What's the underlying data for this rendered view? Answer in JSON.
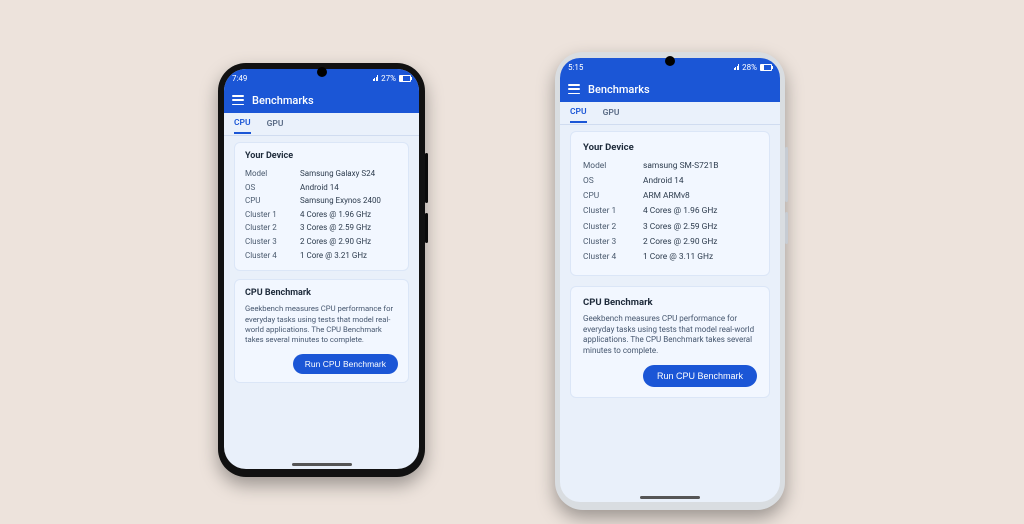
{
  "phones": [
    {
      "status": {
        "time": "7:49",
        "battery_pct": "27%"
      },
      "app_title": "Benchmarks",
      "tabs": {
        "cpu": "CPU",
        "gpu": "GPU"
      },
      "device_card_title": "Your Device",
      "specs": [
        {
          "label": "Model",
          "value": "Samsung Galaxy S24"
        },
        {
          "label": "OS",
          "value": "Android 14"
        },
        {
          "label": "CPU",
          "value": "Samsung Exynos 2400"
        },
        {
          "label": "Cluster 1",
          "value": "4 Cores @ 1.96 GHz"
        },
        {
          "label": "Cluster 2",
          "value": "3 Cores @ 2.59 GHz"
        },
        {
          "label": "Cluster 3",
          "value": "2 Cores @ 2.90 GHz"
        },
        {
          "label": "Cluster 4",
          "value": "1 Core @ 3.21 GHz"
        }
      ],
      "bench_card_title": "CPU Benchmark",
      "bench_desc": "Geekbench measures CPU performance for everyday tasks using tests that model real-world applications. The CPU Benchmark takes several minutes to complete.",
      "run_label": "Run CPU Benchmark"
    },
    {
      "status": {
        "time": "5:15",
        "battery_pct": "28%"
      },
      "app_title": "Benchmarks",
      "tabs": {
        "cpu": "CPU",
        "gpu": "GPU"
      },
      "device_card_title": "Your Device",
      "specs": [
        {
          "label": "Model",
          "value": "samsung SM-S721B"
        },
        {
          "label": "OS",
          "value": "Android 14"
        },
        {
          "label": "CPU",
          "value": "ARM ARMv8"
        },
        {
          "label": "Cluster 1",
          "value": "4 Cores @ 1.96 GHz"
        },
        {
          "label": "Cluster 2",
          "value": "3 Cores @ 2.59 GHz"
        },
        {
          "label": "Cluster 3",
          "value": "2 Cores @ 2.90 GHz"
        },
        {
          "label": "Cluster 4",
          "value": "1 Core @ 3.11 GHz"
        }
      ],
      "bench_card_title": "CPU Benchmark",
      "bench_desc": "Geekbench measures CPU performance for everyday tasks using tests that model real-world applications. The CPU Benchmark takes several minutes to complete.",
      "run_label": "Run CPU Benchmark"
    }
  ]
}
